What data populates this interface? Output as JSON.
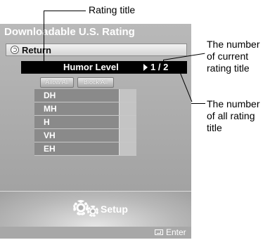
{
  "panel": {
    "title": "Downloadable U.S. Rating",
    "return_label": "Return",
    "level_title": "Humor Level",
    "level_page": "1 / 2",
    "allow_all_label": "Allow All",
    "block_all_label": "Block All",
    "ratings": [
      {
        "label": "DH"
      },
      {
        "label": "MH"
      },
      {
        "label": "H"
      },
      {
        "label": "VH"
      },
      {
        "label": "EH"
      }
    ],
    "setup_label": "Setup",
    "enter_label": "Enter"
  },
  "callouts": {
    "rating_title": "Rating title",
    "current_title": [
      "The number",
      "of current",
      "rating title"
    ],
    "all_titles": [
      "The number",
      "of all rating",
      "title"
    ]
  },
  "icons": {
    "return": "return-icon",
    "arrow": "arrow-right-icon",
    "setup": "gear-icon",
    "enter": "enter-icon"
  },
  "colors": {
    "panel_bg": "#a5a5a5",
    "highlight_row": "#000000",
    "text_light": "#ffffff"
  }
}
